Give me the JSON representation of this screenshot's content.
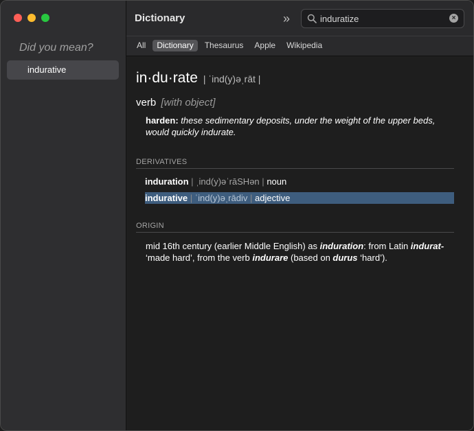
{
  "sidebar": {
    "did_you_mean": "Did you mean?",
    "suggestions": [
      {
        "label": "indurative"
      }
    ]
  },
  "toolbar": {
    "title": "Dictionary",
    "chevron": "»",
    "search": {
      "value": "induratize"
    },
    "tabs": [
      {
        "label": "All"
      },
      {
        "label": "Dictionary"
      },
      {
        "label": "Thesaurus"
      },
      {
        "label": "Apple"
      },
      {
        "label": "Wikipedia"
      }
    ],
    "active_tab": "Dictionary"
  },
  "entry": {
    "headword": "in·du·rate",
    "pronunciation": "| ˈind(y)əˌrāt |",
    "part_of_speech": "verb",
    "pos_note": "[with object]",
    "definition": {
      "word": "harden:",
      "example": "these sedimentary deposits, under the weight of the upper beds, would quickly indurate."
    },
    "derivatives_heading": "DERIVATIVES",
    "derivatives": [
      {
        "word": "induration",
        "pron": "ˌind(y)əˈrāSHən",
        "pos": "noun"
      },
      {
        "word": "indurative",
        "pron": "ˈind(y)əˌrādiv",
        "pos": "adjective"
      }
    ],
    "origin_heading": "ORIGIN",
    "origin": {
      "t1": "mid 16th century (earlier Middle English) as ",
      "w1": "induration",
      "t2": ": from Latin ",
      "w2": "indurat-",
      "t3": " ‘made hard’, from the verb ",
      "w3": "indurare",
      "t4": " (based on ",
      "w4": "durus",
      "t5": " ‘hard’)."
    }
  },
  "colors": {
    "selection": "#3e5d7e",
    "sidebar_bg": "#2e2e30",
    "content_bg": "#1e1e1e"
  }
}
